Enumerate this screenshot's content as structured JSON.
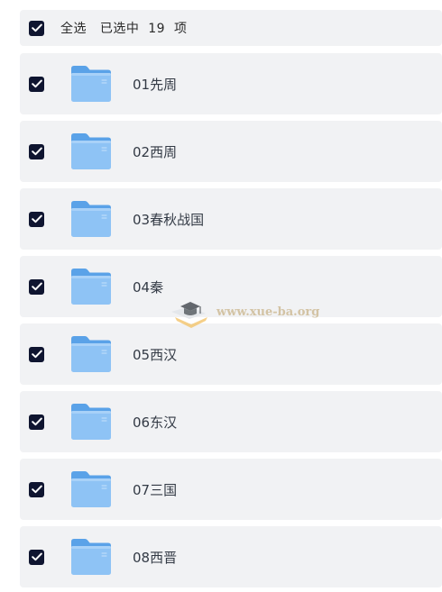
{
  "header": {
    "select_all_label": "全选   已选中  19  项",
    "checked": true
  },
  "folders": [
    {
      "name": "01先周",
      "checked": true
    },
    {
      "name": "02西周",
      "checked": true
    },
    {
      "name": "03春秋战国",
      "checked": true
    },
    {
      "name": "04秦",
      "checked": true
    },
    {
      "name": "05西汉",
      "checked": true
    },
    {
      "name": "06东汉",
      "checked": true
    },
    {
      "name": "07三国",
      "checked": true
    },
    {
      "name": "08西晋",
      "checked": true
    }
  ],
  "icons": {
    "checkbox": "checkmark-icon",
    "folder": "folder-icon",
    "watermark_logo": "graduation-cap-icon"
  },
  "colors": {
    "checkbox_fill": "#0f1530",
    "row_background": "#f1f2f4",
    "folder_blue": "#7cb8f0",
    "watermark": "#c9b48a"
  },
  "watermark": {
    "text": "www.xue-ba.org"
  }
}
